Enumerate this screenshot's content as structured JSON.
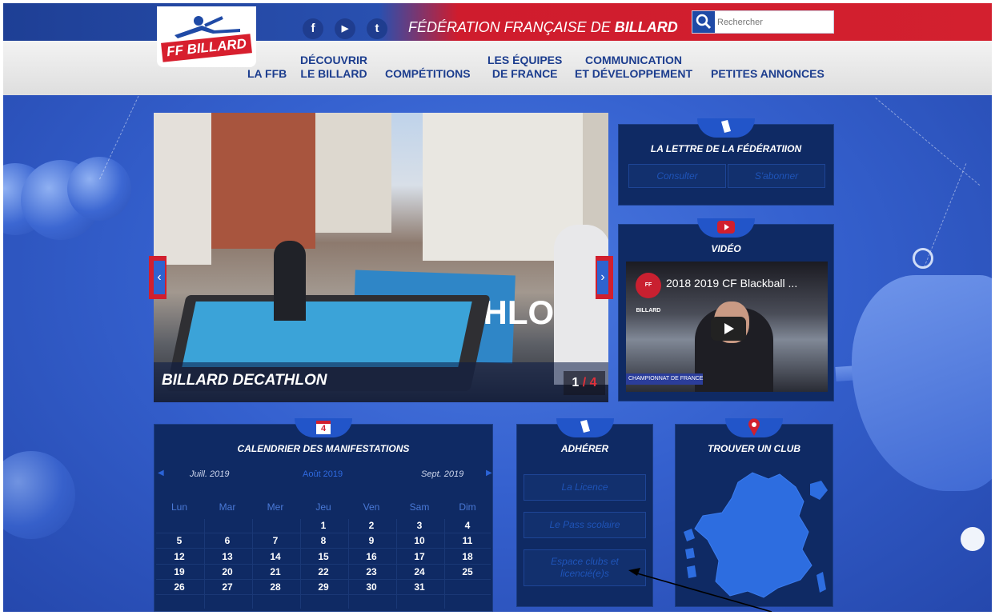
{
  "header": {
    "logo_text": "FF BILLARD",
    "federation_title_part1": "FÉDÉRATION FRANÇAISE DE",
    "federation_title_part2": "BILLARD",
    "social": {
      "facebook": "f",
      "youtube": "▶",
      "twitter": "t"
    },
    "search_placeholder": "Rechercher"
  },
  "nav": {
    "items": [
      {
        "line1": "LA FFB",
        "line2": ""
      },
      {
        "line1": "DÉCOUVRIR",
        "line2": "LE BILLARD"
      },
      {
        "line1": "COMPÉTITIONS",
        "line2": ""
      },
      {
        "line1": "LES ÉQUIPES",
        "line2": "DE FRANCE"
      },
      {
        "line1": "COMMUNICATION",
        "line2": "ET DÉVELOPPEMENT"
      },
      {
        "line1": "PETITES ANNONCES",
        "line2": ""
      }
    ]
  },
  "slider": {
    "caption": "BILLARD DECATHLON",
    "current": "1",
    "separator": "/",
    "total": "4",
    "banner_text": "DECATHLON",
    "prev": "‹",
    "next": "›"
  },
  "lettre": {
    "title": "LA LETTRE DE LA FÉDÉRATIION",
    "consult": "Consulter",
    "subscribe": "S'abonner"
  },
  "video": {
    "title": "VIDÉO",
    "video_title": "2018 2019 CF Blackball ...",
    "channel_logo": "FF BILLARD",
    "lower_third": "CHAMPIONNAT DE FRANCE"
  },
  "calendar": {
    "title": "CALENDRIER DES MANIFESTATIONS",
    "icon_day": "4",
    "prev_month": "Juill. 2019",
    "current_month": "Août 2019",
    "next_month": "Sept. 2019",
    "weekdays": [
      "Lun",
      "Mar",
      "Mer",
      "Jeu",
      "Ven",
      "Sam",
      "Dim"
    ],
    "weeks": [
      [
        "",
        "",
        "",
        "1",
        "2",
        "3",
        "4"
      ],
      [
        "5",
        "6",
        "7",
        "8",
        "9",
        "10",
        "11"
      ],
      [
        "12",
        "13",
        "14",
        "15",
        "16",
        "17",
        "18"
      ],
      [
        "19",
        "20",
        "21",
        "22",
        "23",
        "24",
        "25"
      ],
      [
        "26",
        "27",
        "28",
        "29",
        "30",
        "31",
        ""
      ]
    ]
  },
  "adherer": {
    "title": "ADHÉRER",
    "licence": "La Licence",
    "pass": "Le Pass scolaire",
    "espace_line1": "Espace clubs et",
    "espace_line2": "licencié(e)s"
  },
  "club": {
    "title": "TROUVER UN CLUB"
  },
  "colors": {
    "brand_blue": "#1c3d8e",
    "brand_red": "#d11f2e",
    "panel_bg": "#0f2a64",
    "background": "#3561cf"
  }
}
